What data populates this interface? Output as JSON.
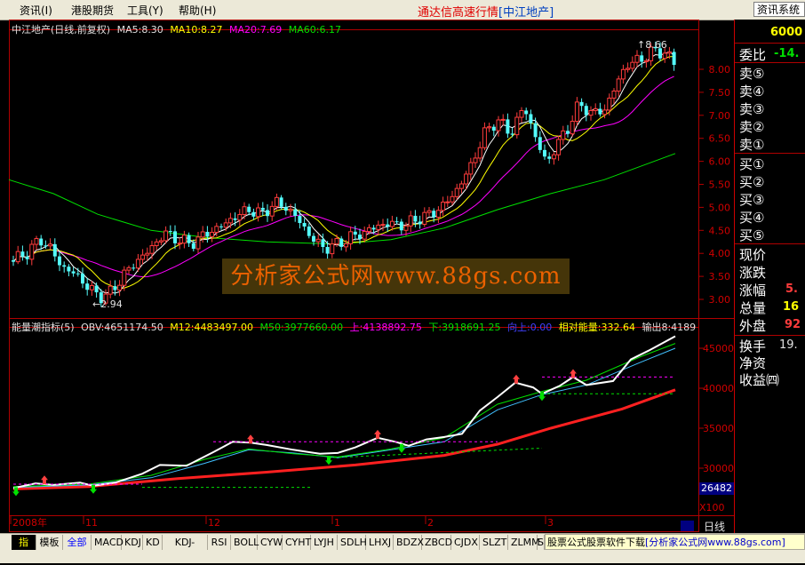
{
  "menu": {
    "items": [
      "资讯(I)",
      "港股期货",
      "工具(Y)",
      "帮助(H)"
    ],
    "app_title": "通达信高速行情",
    "stock_tag": "[中江地产]",
    "right_button": "资讯系统"
  },
  "main_chart": {
    "legend_name": "中江地产(日线,前复权)",
    "ma5": "MA5:8.30",
    "ma10": "MA10:8.27",
    "ma20": "MA20:7.69",
    "ma60": "MA60:6.17",
    "high_marker": "8.66",
    "low_marker": "2.94",
    "y_ticks": [
      "8.00",
      "7.50",
      "7.00",
      "6.50",
      "6.00",
      "5.50",
      "5.00",
      "4.50",
      "4.00",
      "3.50",
      "3.00"
    ],
    "colors": {
      "up": "#ff3c3c",
      "down": "#54fcfc",
      "ma5": "#ffffff",
      "ma10": "#ffff00",
      "ma20": "#ff00ff",
      "ma60": "#00e000"
    }
  },
  "indicator_chart": {
    "name": "能量潮指标(5)",
    "obv": "OBV:4651174.50",
    "m12": "M12:4483497.00",
    "m50": "M50:3977660.00",
    "shang": "上:4138892.75",
    "xia": "下:3918691.25",
    "xiangshang": "向上:0.00",
    "xiangdui": "相对能量:332.64",
    "shuchu": "输出8:4189",
    "y_ticks": [
      "45000",
      "40000",
      "35000",
      "30000"
    ],
    "badge_value": "26482",
    "badge_unit": "X100"
  },
  "x_axis": {
    "labels": [
      "2008年",
      "11",
      "12",
      "1",
      "2",
      "3"
    ],
    "period": "日线"
  },
  "right_panel": {
    "top_value": "6000",
    "weibi_label": "委比",
    "weibi_value": "-14.",
    "sell": [
      "卖⑤",
      "卖④",
      "卖③",
      "卖②",
      "卖①"
    ],
    "buy": [
      "买①",
      "买②",
      "买③",
      "买④",
      "买⑤"
    ],
    "quote_labels": [
      "现价",
      "涨跌",
      "涨幅",
      "总量",
      "外盘"
    ],
    "quote_values": [
      "",
      "",
      "5.",
      "16",
      "92"
    ],
    "bottom_labels": [
      "换手",
      "净资",
      "收益㈣"
    ],
    "huanshou_value": "19."
  },
  "toolbar": {
    "tabs": [
      "指标",
      "模板",
      "全部",
      "MACD",
      "KDJ",
      "KD",
      "KDJ-TDX",
      "RSI",
      "BOLL",
      "CYW",
      "CYHT",
      "LYJH",
      "SDLH",
      "LHXJ",
      "BDZX",
      "ZBCD",
      "CJDX",
      "SLZT",
      "ZLMM",
      "S"
    ],
    "ad_main": "股票公式股票软件下载",
    "ad_site": "[分析家公式网www.88gs.com]"
  },
  "watermark": "分析家公式网www.88gs.com"
}
